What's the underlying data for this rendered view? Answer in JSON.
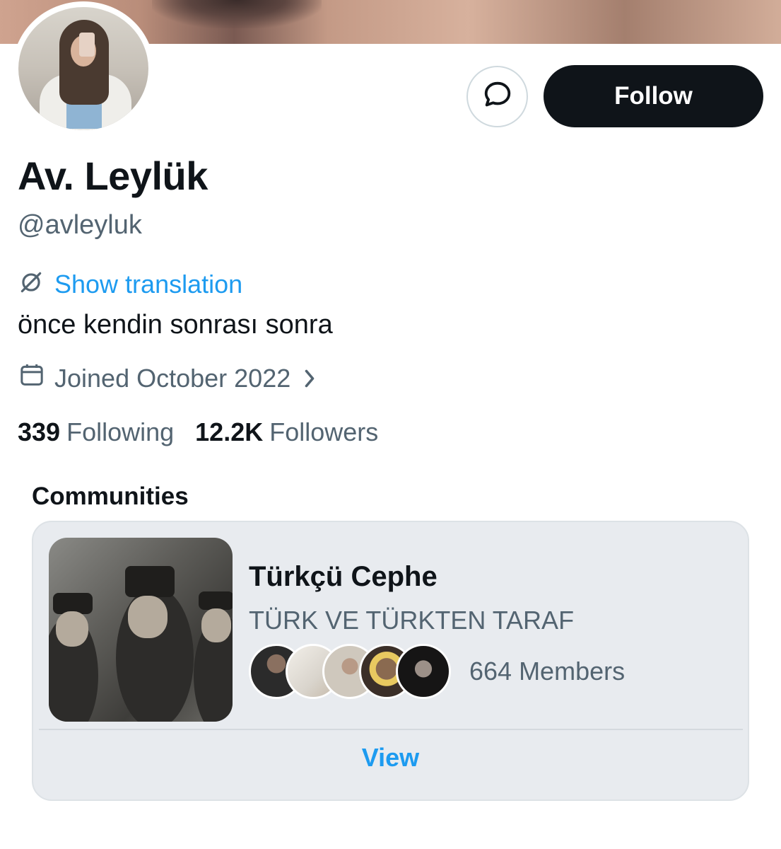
{
  "profile": {
    "display_name": "Av. Leylük",
    "handle": "@avleyluk",
    "bio": "önce kendin sonrası sonra",
    "joined": "Joined October 2022"
  },
  "actions": {
    "message_icon": "message-bubble-icon",
    "follow_label": "Follow"
  },
  "translation": {
    "label": "Show translation",
    "icon": "translate-icon"
  },
  "stats": {
    "following_count": "339",
    "following_label": "Following",
    "followers_count": "12.2K",
    "followers_label": "Followers"
  },
  "communities": {
    "heading": "Communities",
    "items": [
      {
        "name": "Türkçü Cephe",
        "description": "TÜRK VE TÜRKTEN TARAF",
        "members_label": "664 Members",
        "view_label": "View"
      }
    ]
  },
  "colors": {
    "accent": "#1d9bf0",
    "text_primary": "#0f1419",
    "text_secondary": "#536471",
    "follow_bg": "#0f1419",
    "card_bg": "#e8ebef"
  }
}
